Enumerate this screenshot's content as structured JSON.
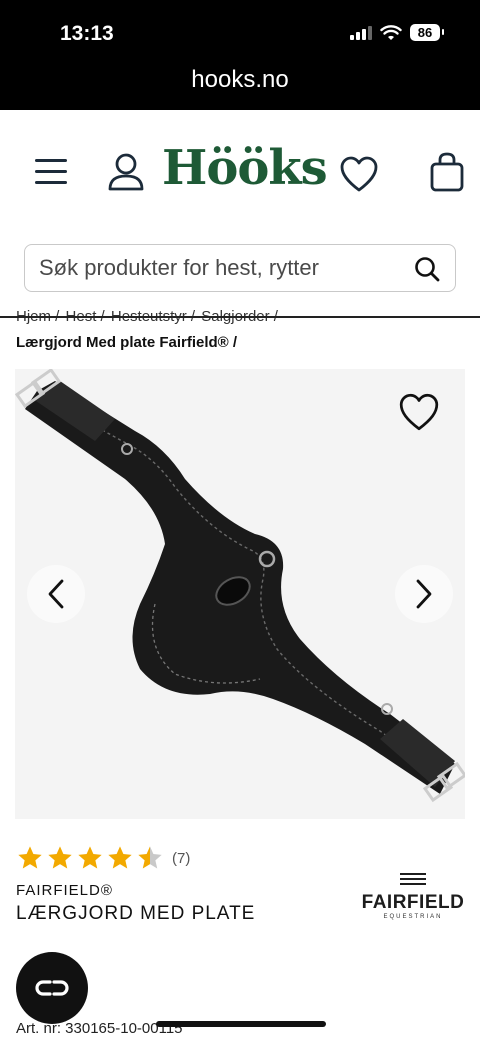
{
  "status_bar": {
    "time": "13:13",
    "battery": "86"
  },
  "browser": {
    "url": "hooks.no"
  },
  "header": {
    "logo": "Hööks"
  },
  "search": {
    "placeholder": "Søk produkter for hest, rytter"
  },
  "breadcrumb": {
    "items": [
      "Hjem /",
      "Hest /",
      "Hesteutstyr /",
      "Salgjorder /"
    ],
    "current": "Lærgjord Med plate Fairfield® /"
  },
  "product": {
    "rating_count": "(7)",
    "rating_value": 4.5,
    "brand": "FAIRFIELD®",
    "title": "LÆRGJORD MED PLATE",
    "article_number": "Art. nr: 330165-10-00115"
  },
  "brand_logo": {
    "main": "FAIRFIELD",
    "sub": "EQUESTRIAN"
  },
  "colors": {
    "brand_green": "#1e5a36",
    "star": "#f2a900",
    "background": "#ffffff"
  },
  "icons": [
    "menu-icon",
    "user-icon",
    "heart-icon",
    "cart-icon",
    "search-icon",
    "chevron-left-icon",
    "chevron-right-icon",
    "star-icon",
    "chat-icon"
  ]
}
